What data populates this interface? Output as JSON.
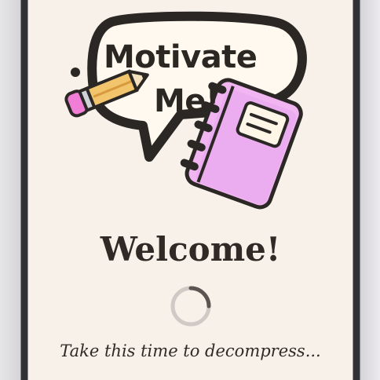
{
  "logo": {
    "line1": "Motivate",
    "line2": "Me!",
    "icons": [
      "speech-bubble-icon",
      "pencil-icon",
      "notebook-icon"
    ]
  },
  "welcome": "Welcome!",
  "loading": {
    "icon": "loading-spinner-icon"
  },
  "tagline": "Take this time to decompress...",
  "colors": {
    "background": "#f8f1ea",
    "frame": "#2f3136",
    "text": "#2f2a25",
    "notebook": "#f0b6f0",
    "pencil": "#f2c46b",
    "spinner": "#cfcac6"
  }
}
